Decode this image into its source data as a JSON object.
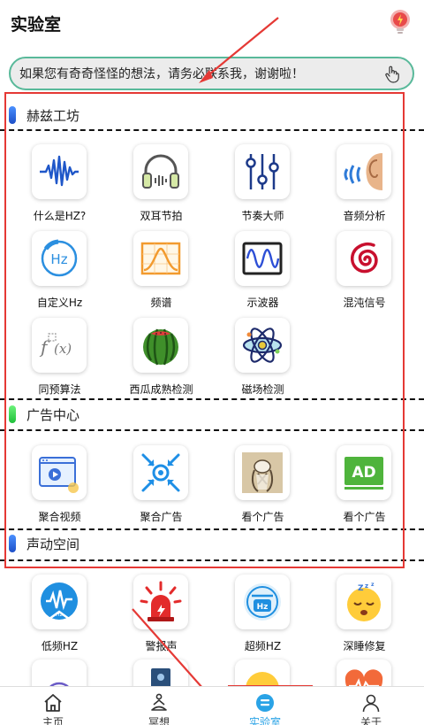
{
  "header": {
    "title": "实验室",
    "bulb_icon": "lightbulb-icon"
  },
  "notice": {
    "text": "如果您有奇奇怪怪的想法，请务必联系我，谢谢啦！",
    "icon": "hand-pointer-icon"
  },
  "sections": [
    {
      "title": "赫兹工坊",
      "color": "#2f6fe0",
      "items": [
        {
          "label": "什么是HZ?",
          "icon": "waveform-icon"
        },
        {
          "label": "双耳节拍",
          "icon": "headphones-icon"
        },
        {
          "label": "节奏大师",
          "icon": "sliders-icon"
        },
        {
          "label": "音频分析",
          "icon": "ear-sound-icon"
        },
        {
          "label": "自定义Hz",
          "icon": "hz-circle-icon"
        },
        {
          "label": "频谱",
          "icon": "spectrum-icon"
        },
        {
          "label": "示波器",
          "icon": "oscilloscope-icon"
        },
        {
          "label": "混沌信号",
          "icon": "spiral-icon"
        },
        {
          "label": "同预算法",
          "icon": "function-icon"
        },
        {
          "label": "西瓜成熟检测",
          "icon": "watermelon-icon"
        },
        {
          "label": "磁场检测",
          "icon": "atom-icon"
        }
      ]
    },
    {
      "title": "广告中心",
      "color": "#2ecc40",
      "items": [
        {
          "label": "聚合视频",
          "icon": "video-window-icon"
        },
        {
          "label": "聚合广告",
          "icon": "target-arrows-icon"
        },
        {
          "label": "看个广告",
          "icon": "figure-image-icon"
        },
        {
          "label": "看个广告",
          "icon": "ad-board-icon"
        }
      ]
    },
    {
      "title": "声动空间",
      "color": "#2f6fe0",
      "items": [
        {
          "label": "低频HZ",
          "icon": "low-frequency-icon"
        },
        {
          "label": "警报声",
          "icon": "alarm-siren-icon"
        },
        {
          "label": "超频HZ",
          "icon": "high-frequency-icon"
        },
        {
          "label": "深睡修复",
          "icon": "sleepy-face-icon"
        },
        {
          "label": "",
          "icon": "sound-rings-icon"
        },
        {
          "label": "",
          "icon": "speaker-icon"
        },
        {
          "label": "",
          "icon": "smile-face-icon"
        },
        {
          "label": "",
          "icon": "heart-wave-icon"
        }
      ]
    }
  ],
  "nav": [
    {
      "label": "主页",
      "icon": "home-icon",
      "active": false
    },
    {
      "label": "冥想",
      "icon": "meditation-icon",
      "active": false
    },
    {
      "label": "实验室",
      "icon": "lab-icon",
      "active": true
    },
    {
      "label": "关于",
      "icon": "user-icon",
      "active": false
    }
  ],
  "colors": {
    "accent": "#2aa3e6",
    "annotation": "#e53935",
    "notice_border": "#59b99a"
  }
}
